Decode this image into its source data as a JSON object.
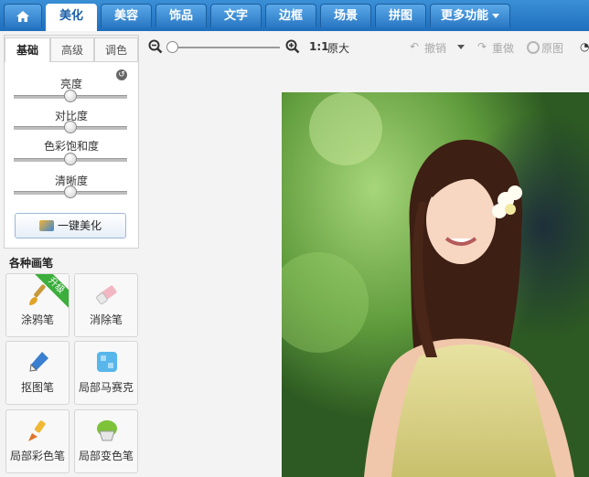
{
  "nav": {
    "home_icon": "home-icon",
    "tabs": [
      "美化",
      "美容",
      "饰品",
      "文字",
      "边框",
      "场景",
      "拼图"
    ],
    "more": "更多功能"
  },
  "panel": {
    "subtabs": [
      "基础",
      "高级",
      "调色"
    ],
    "sliders": [
      {
        "label": "亮度",
        "value": 0.5
      },
      {
        "label": "对比度",
        "value": 0.5
      },
      {
        "label": "色彩饱和度",
        "value": 0.5
      },
      {
        "label": "清晰度",
        "value": 0.5
      }
    ],
    "one_key": "一键美化"
  },
  "brushes": {
    "title": "各种画笔",
    "items": [
      {
        "label": "涂鸦笔",
        "icon": "brush-icon",
        "badge": "升级"
      },
      {
        "label": "消除笔",
        "icon": "eraser-icon"
      },
      {
        "label": "抠图笔",
        "icon": "pen-icon"
      },
      {
        "label": "局部马赛克",
        "icon": "mosaic-icon"
      },
      {
        "label": "局部彩色笔",
        "icon": "color-brush-icon"
      },
      {
        "label": "局部变色笔",
        "icon": "paint-bucket-icon"
      }
    ]
  },
  "toolbar": {
    "zoom_value": 0.0,
    "ratio": "1:1",
    "original_size": "原大",
    "undo": "撤销",
    "redo": "重做",
    "original": "原图"
  },
  "colors": {
    "nav_bg": "#2a78c4",
    "badge": "#3cae3c"
  }
}
